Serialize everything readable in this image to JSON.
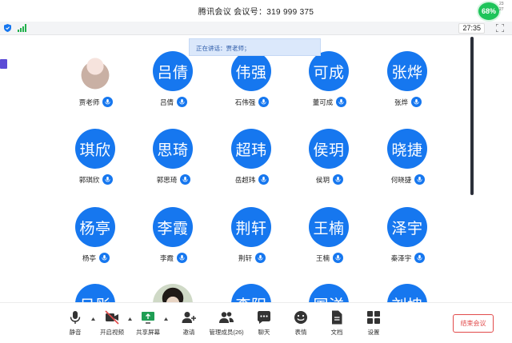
{
  "window": {
    "title": "腾讯会议  会议号：319 999 375"
  },
  "perf": {
    "cpu": "68%",
    "stat_up": "23",
    "stat_down": "27"
  },
  "infobar": {
    "timer": "27:35"
  },
  "speaking": {
    "label": "正在讲话：贾老师；"
  },
  "participants": [
    {
      "avatar": "",
      "name": "贾老师",
      "kind": "photo"
    },
    {
      "avatar": "吕倩",
      "name": "吕倩"
    },
    {
      "avatar": "伟强",
      "name": "石伟强"
    },
    {
      "avatar": "可成",
      "name": "董可成"
    },
    {
      "avatar": "张烨",
      "name": "张烨"
    },
    {
      "avatar": "琪欣",
      "name": "郭琪欣"
    },
    {
      "avatar": "思琦",
      "name": "郭思琦"
    },
    {
      "avatar": "超玮",
      "name": "岳超玮"
    },
    {
      "avatar": "侯玥",
      "name": "侯玥"
    },
    {
      "avatar": "晓捷",
      "name": "何晓捷"
    },
    {
      "avatar": "杨亭",
      "name": "杨亭"
    },
    {
      "avatar": "李霞",
      "name": "李霞"
    },
    {
      "avatar": "荆轩",
      "name": "荆轩"
    },
    {
      "avatar": "王楠",
      "name": "王楠"
    },
    {
      "avatar": "泽宇",
      "name": "秦泽宇"
    },
    {
      "avatar": "日彤",
      "name": ""
    },
    {
      "avatar": "",
      "name": "",
      "kind": "photo2"
    },
    {
      "avatar": "李阳",
      "name": ""
    },
    {
      "avatar": "国洋",
      "name": ""
    },
    {
      "avatar": "刘坤",
      "name": ""
    }
  ],
  "toolbar": {
    "mute": "静音",
    "video": "开启视频",
    "share": "共享屏幕",
    "invite": "邀请",
    "members": "管理成员(26)",
    "chat": "聊天",
    "reactions": "表情",
    "docs": "文档",
    "settings": "设置",
    "end": "结束会议"
  },
  "colors": {
    "accent": "#1677ef",
    "end": "#e24b4b",
    "perf": "#1ec45a"
  }
}
